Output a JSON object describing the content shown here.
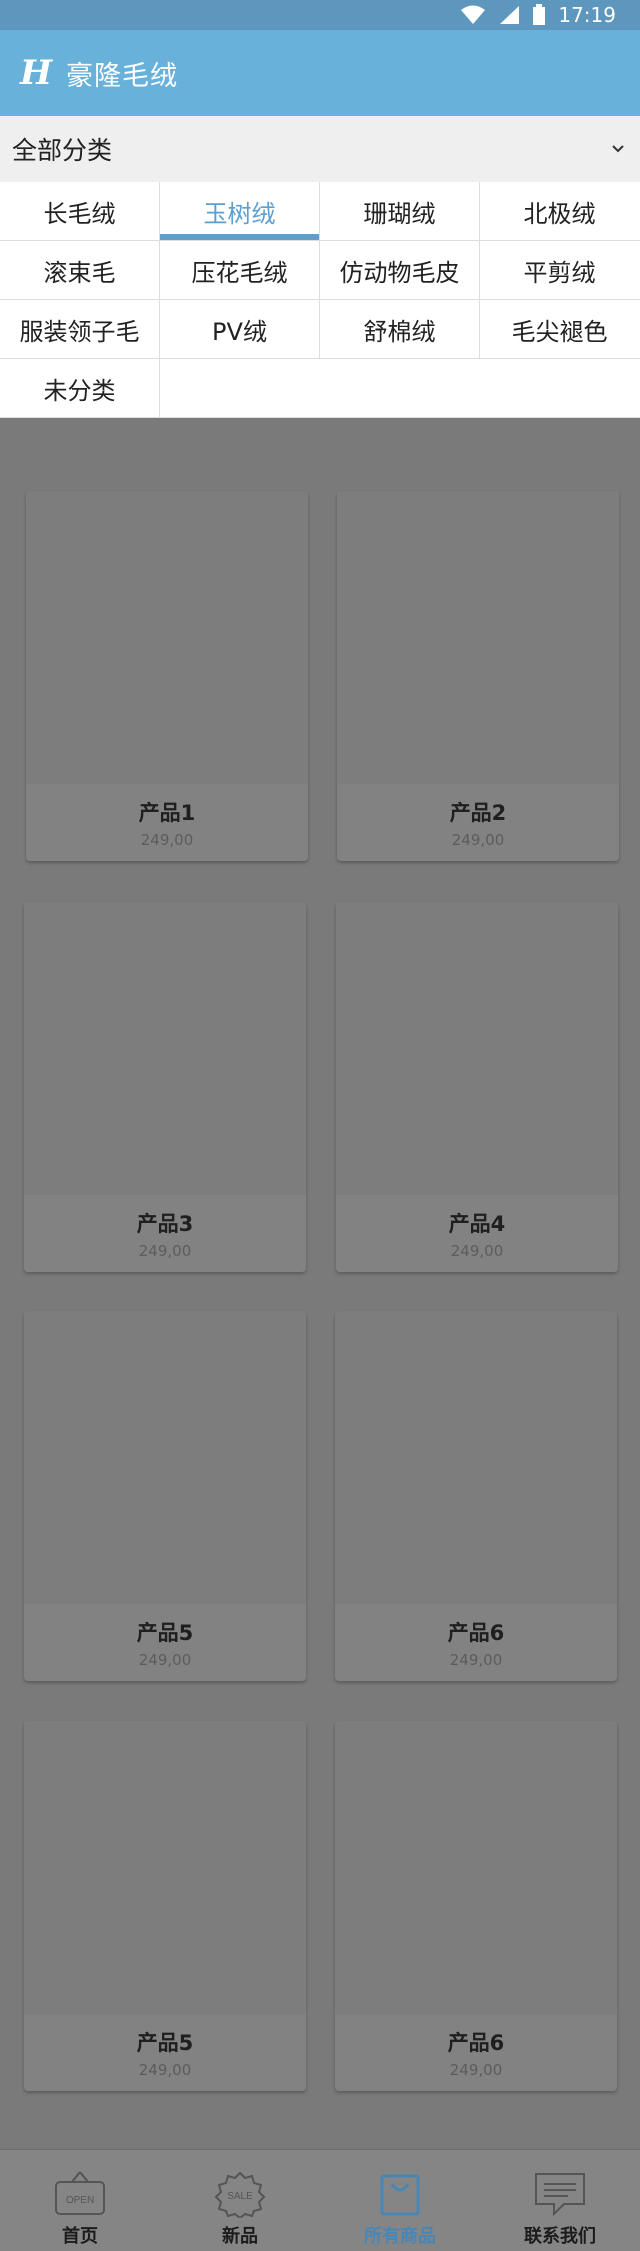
{
  "status": {
    "time": "17:19"
  },
  "app": {
    "logo": "H",
    "title": "豪隆毛绒"
  },
  "category": {
    "label": "全部分类",
    "icon": "chevron-down-icon"
  },
  "categories": [
    [
      "长毛绒",
      "玉树绒",
      "珊瑚绒",
      "北极绒"
    ],
    [
      "滚束毛",
      "压花毛绒",
      "仿动物毛皮",
      "平剪绒"
    ],
    [
      "服装领子毛",
      "PV绒",
      "舒棉绒",
      "毛尖褪色"
    ],
    [
      "未分类"
    ]
  ],
  "active_category": "玉树绒",
  "products": [
    {
      "name": "产品1",
      "price": "249,00"
    },
    {
      "name": "产品2",
      "price": "249,00"
    },
    {
      "name": "产品3",
      "price": "249,00"
    },
    {
      "name": "产品4",
      "price": "249,00"
    },
    {
      "name": "产品5",
      "price": "249,00"
    },
    {
      "name": "产品6",
      "price": "249,00"
    },
    {
      "name": "产品5",
      "price": "249,00"
    },
    {
      "name": "产品6",
      "price": "249,00"
    }
  ],
  "tabs": [
    {
      "label": "首页",
      "icon": "open-sign-icon",
      "icon_text": "OPEN"
    },
    {
      "label": "新品",
      "icon": "sale-badge-icon",
      "icon_text": "SALE"
    },
    {
      "label": "所有商品",
      "icon": "shopping-bag-icon",
      "active": true
    },
    {
      "label": "联系我们",
      "icon": "chat-icon"
    }
  ],
  "colors": {
    "statusbar": "#5d97bd",
    "appbar": "#67b1da",
    "accent": "#5a9fd0",
    "overlay": "#7a7a7a"
  }
}
